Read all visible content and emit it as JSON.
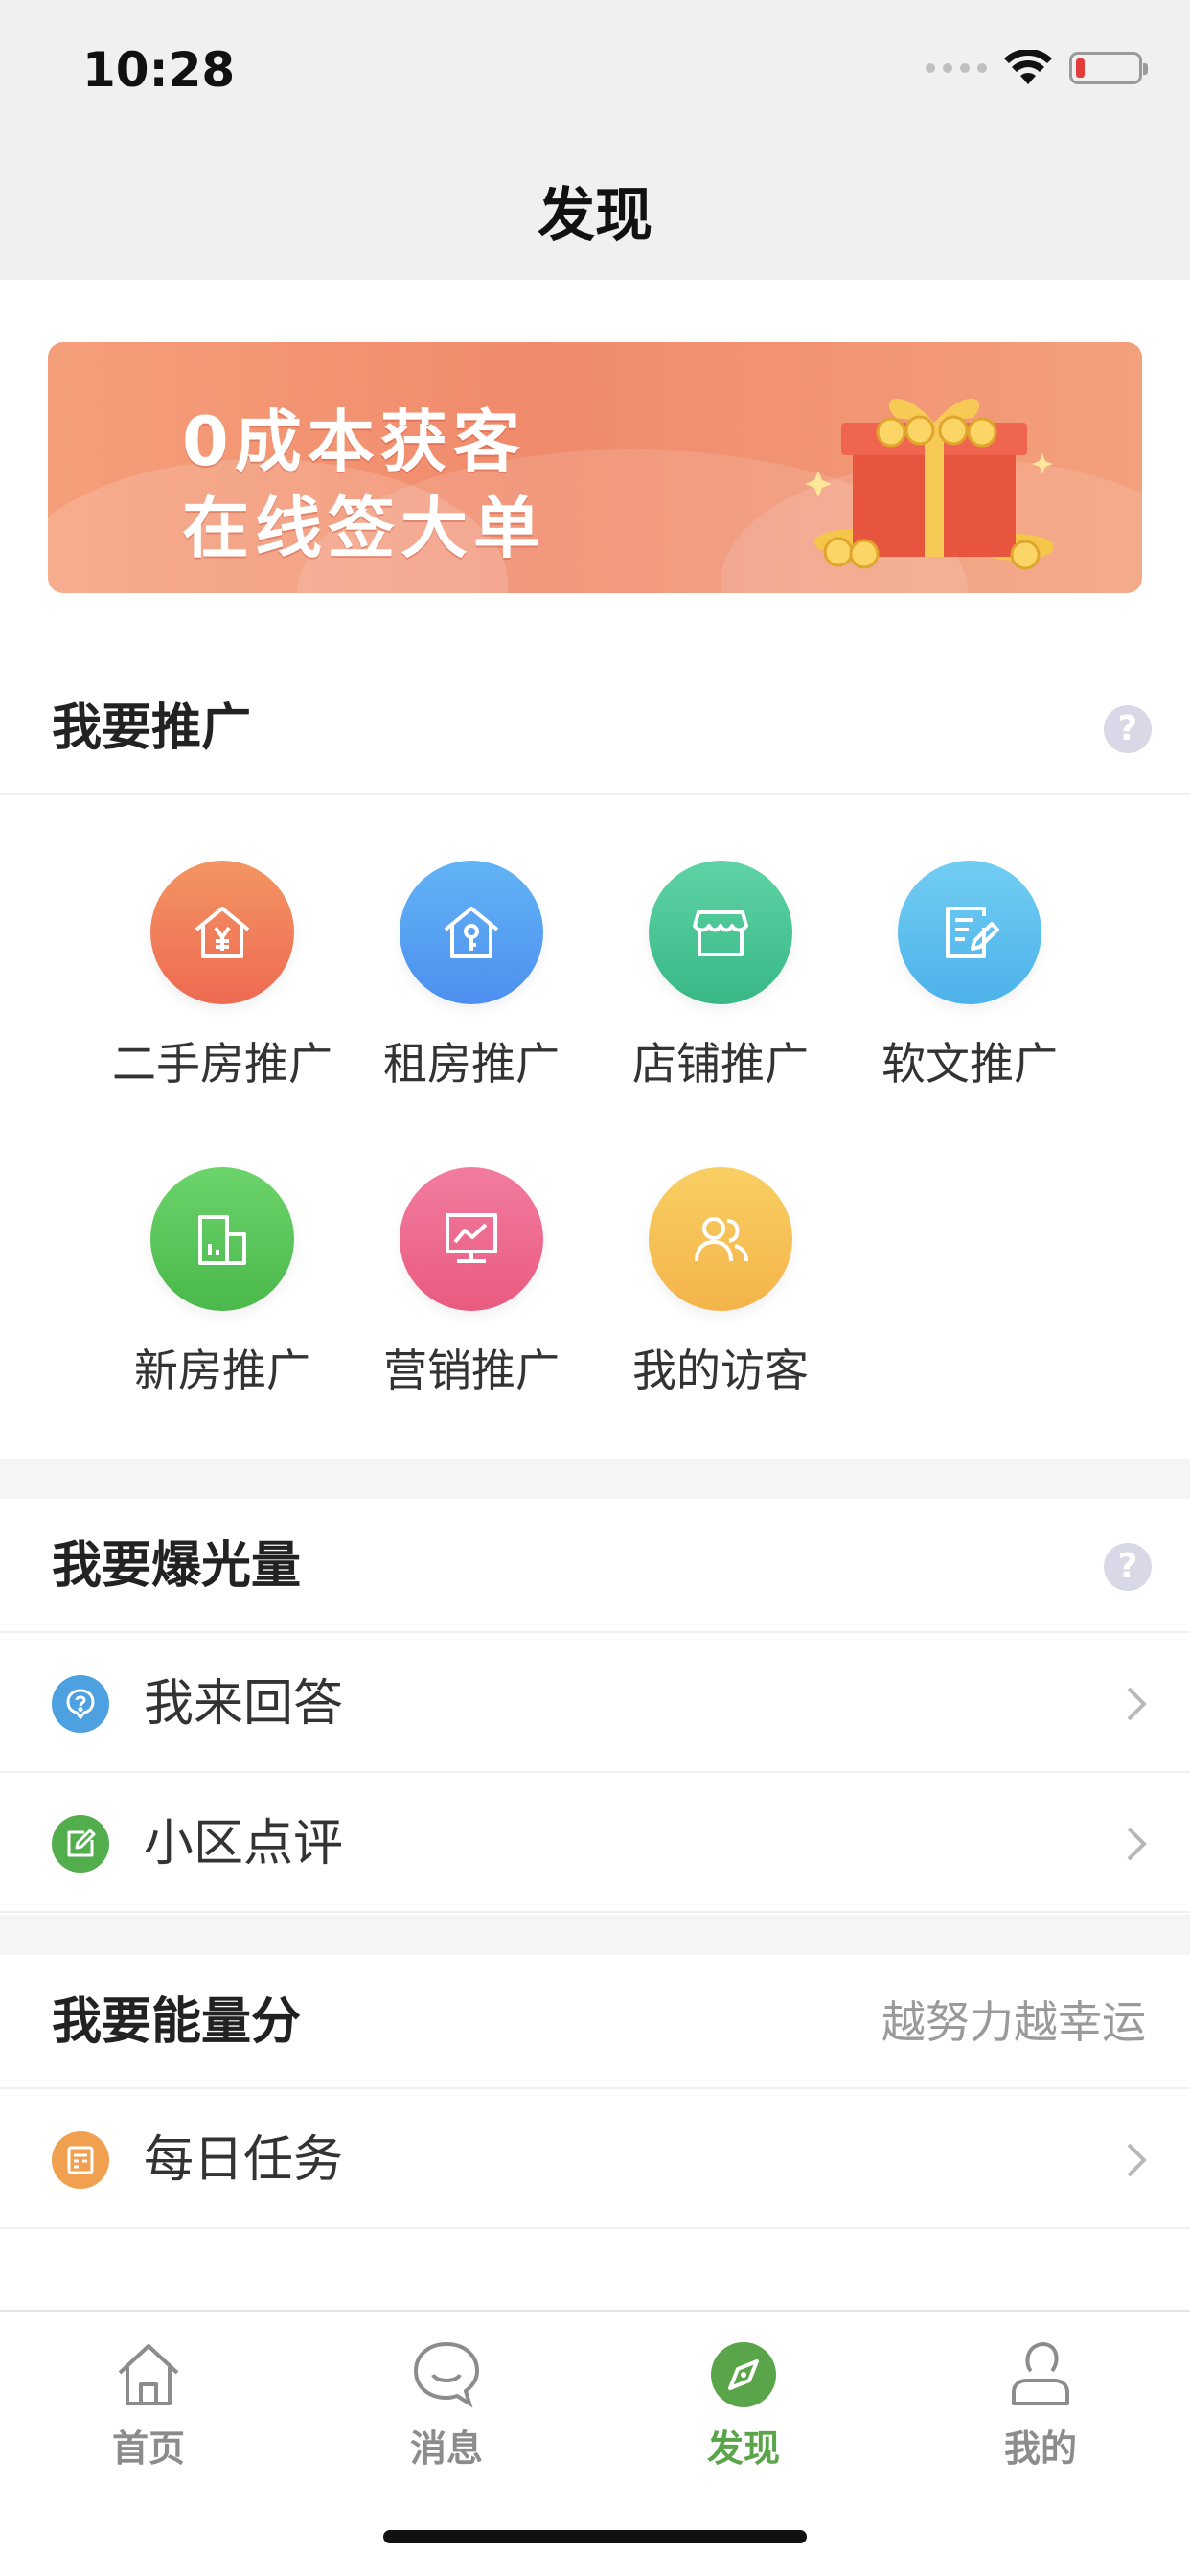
{
  "status_bar": {
    "time": "10:28"
  },
  "nav": {
    "title": "发现"
  },
  "banner": {
    "line1": "0成本获客",
    "line2": "在线签大单"
  },
  "promote": {
    "title": "我要推广",
    "help_icon": "question-icon",
    "items": [
      {
        "label": "二手房推广",
        "icon": "house-yen-icon",
        "color": "#f07a58"
      },
      {
        "label": "租房推广",
        "icon": "house-key-icon",
        "color": "#5aa0f2"
      },
      {
        "label": "店铺推广",
        "icon": "store-icon",
        "color": "#45c79a"
      },
      {
        "label": "软文推广",
        "icon": "edit-doc-icon",
        "color": "#5cc0ee"
      },
      {
        "label": "新房推广",
        "icon": "building-icon",
        "color": "#5fc75b"
      },
      {
        "label": "营销推广",
        "icon": "monitor-chart-icon",
        "color": "#ee6a8e"
      },
      {
        "label": "我的访客",
        "icon": "users-icon",
        "color": "#f6c154"
      }
    ]
  },
  "exposure": {
    "title": "我要爆光量",
    "help_icon": "question-icon",
    "items": [
      {
        "label": "我来回答",
        "icon": "question-bubble-icon",
        "color": "#4ea1e0"
      },
      {
        "label": "小区点评",
        "icon": "edit-icon",
        "color": "#52ae4c"
      }
    ]
  },
  "energy": {
    "title": "我要能量分",
    "hint": "越努力越幸运",
    "items": [
      {
        "label": "每日任务",
        "icon": "task-list-icon",
        "color": "#f0a04e"
      }
    ]
  },
  "tabbar": {
    "active_color": "#5aa54a",
    "tabs": [
      {
        "label": "首页",
        "icon": "home-icon"
      },
      {
        "label": "消息",
        "icon": "message-icon"
      },
      {
        "label": "发现",
        "icon": "compass-icon",
        "active": true
      },
      {
        "label": "我的",
        "icon": "user-icon"
      }
    ]
  }
}
